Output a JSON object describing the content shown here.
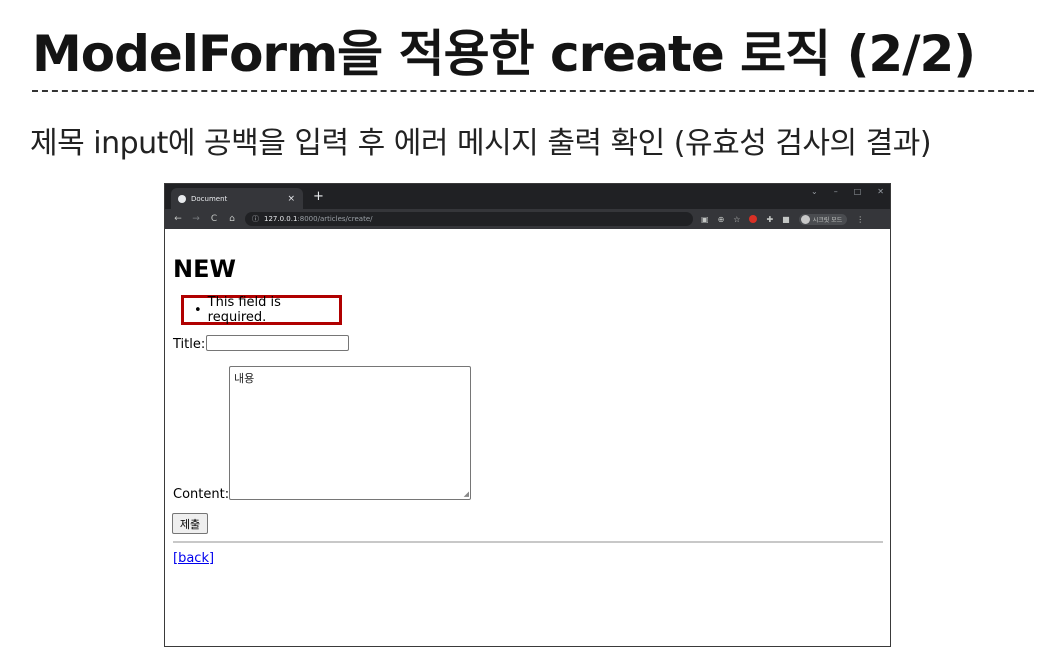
{
  "slide": {
    "title": "ModelForm을 적용한 create 로직 (2/2)",
    "subtitle": "제목 input에 공백을 입력 후 에러 메시지 출력 확인 (유효성 검사의 결과)"
  },
  "browser": {
    "tab_title": "Document",
    "tab_close": "×",
    "new_tab": "+",
    "window_controls": [
      "⌄",
      "–",
      "□",
      "✕"
    ],
    "url_host": "127.0.0.1",
    "url_path": ":8000/articles/create/",
    "profile_label": "시크릿 모드"
  },
  "page": {
    "heading": "NEW",
    "error_message": "This field is required.",
    "title_label": "Title:",
    "title_value": "",
    "content_label": "Content:",
    "content_value": "내용",
    "submit_label": "제출",
    "back_label": "[back]"
  },
  "colors": {
    "error_border": "#b00000",
    "link": "#0000ee",
    "browser_dark": "#202124",
    "browser_toolbar": "#35363a"
  }
}
